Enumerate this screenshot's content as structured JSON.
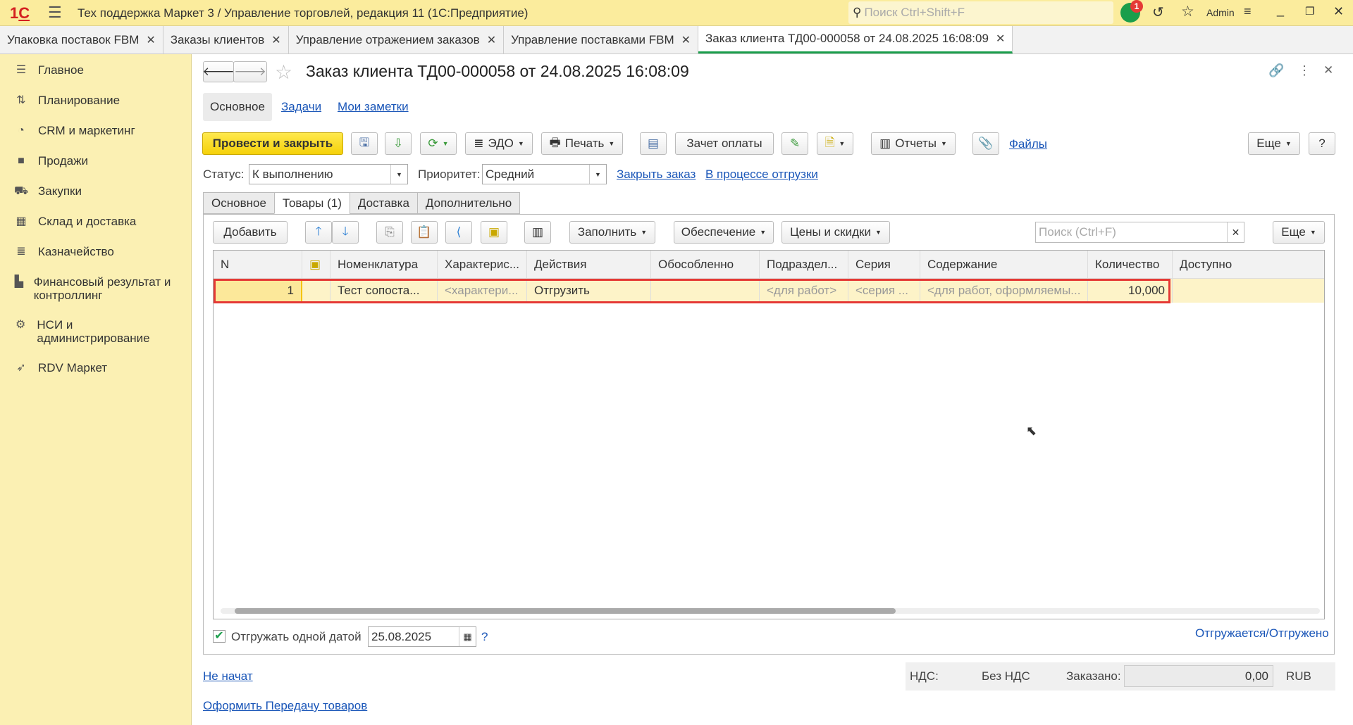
{
  "titlebar": {
    "title": "Тех поддержка Маркет 3 / Управление торговлей, редакция 11  (1С:Предприятие)",
    "search_placeholder": "Поиск Ctrl+Shift+F",
    "notif_count": "1",
    "user": "Admin"
  },
  "window_tabs": [
    {
      "label": "Упаковка поставок FBM"
    },
    {
      "label": "Заказы клиентов"
    },
    {
      "label": "Управление отражением заказов"
    },
    {
      "label": "Управление поставками FBM"
    },
    {
      "label": "Заказ клиента ТД00-000058 от 24.08.2025 16:08:09",
      "active": true
    }
  ],
  "sidebar": {
    "items": [
      {
        "label": "Главное",
        "icon": "menu-icon"
      },
      {
        "label": "Планирование",
        "icon": "chart-icon"
      },
      {
        "label": "CRM и маркетинг",
        "icon": "pie-icon"
      },
      {
        "label": "Продажи",
        "icon": "bag-icon"
      },
      {
        "label": "Закупки",
        "icon": "cart-icon"
      },
      {
        "label": "Склад и доставка",
        "icon": "grid-icon"
      },
      {
        "label": "Казначейство",
        "icon": "coins-icon"
      },
      {
        "label": "Финансовый результат и контроллинг",
        "icon": "bar-chart-icon"
      },
      {
        "label": "НСИ и администрирование",
        "icon": "gear-icon"
      },
      {
        "label": "RDV Маркет",
        "icon": "rocket-icon"
      }
    ]
  },
  "form": {
    "title": "Заказ клиента ТД00-000058 от 24.08.2025 16:08:09",
    "subtabs": [
      "Основное",
      "Задачи",
      "Мои заметки"
    ],
    "toolbar": {
      "post_close": "Провести и закрыть",
      "edo": "ЭДО",
      "print": "Печать",
      "offset": "Зачет оплаты",
      "reports": "Отчеты",
      "files": "Файлы",
      "more": "Еще",
      "help": "?"
    },
    "status_label": "Статус:",
    "status_value": "К выполнению",
    "priority_label": "Приоритет:",
    "priority_value": "Средний",
    "close_order": "Закрыть заказ",
    "shipping_state": "В процессе отгрузки",
    "tabs": [
      "Основное",
      "Товары (1)",
      "Доставка",
      "Дополнительно"
    ],
    "table_toolbar": {
      "add": "Добавить",
      "fill": "Заполнить",
      "supply": "Обеспечение",
      "prices": "Цены и скидки",
      "search_placeholder": "Поиск (Ctrl+F)",
      "more": "Еще"
    },
    "columns": [
      "N",
      "",
      "Номенклатура",
      "Характерис...",
      "Действия",
      "Обособленно",
      "Подраздел...",
      "Серия",
      "Содержание",
      "Количество",
      "Доступно"
    ],
    "rows": [
      [
        "1",
        "",
        "Тест сопоста...",
        "<характери...",
        "Отгрузить",
        "",
        "<для работ>",
        "<серия ...",
        "<для работ, оформляемы...",
        "10,000",
        ""
      ]
    ],
    "ship_one_date_label": "Отгружать одной датой",
    "ship_one_date_checked": true,
    "ship_date": "25.08.2025",
    "ship_help": "?",
    "shipped_link": "Отгружается/Отгружено",
    "not_started": "Не начат",
    "transfer_link": "Оформить Передачу товаров",
    "vat_label": "НДС:",
    "vat_value": "Без НДС",
    "ordered_label": "Заказано:",
    "ordered_value": "0,00",
    "currency": "RUB"
  }
}
